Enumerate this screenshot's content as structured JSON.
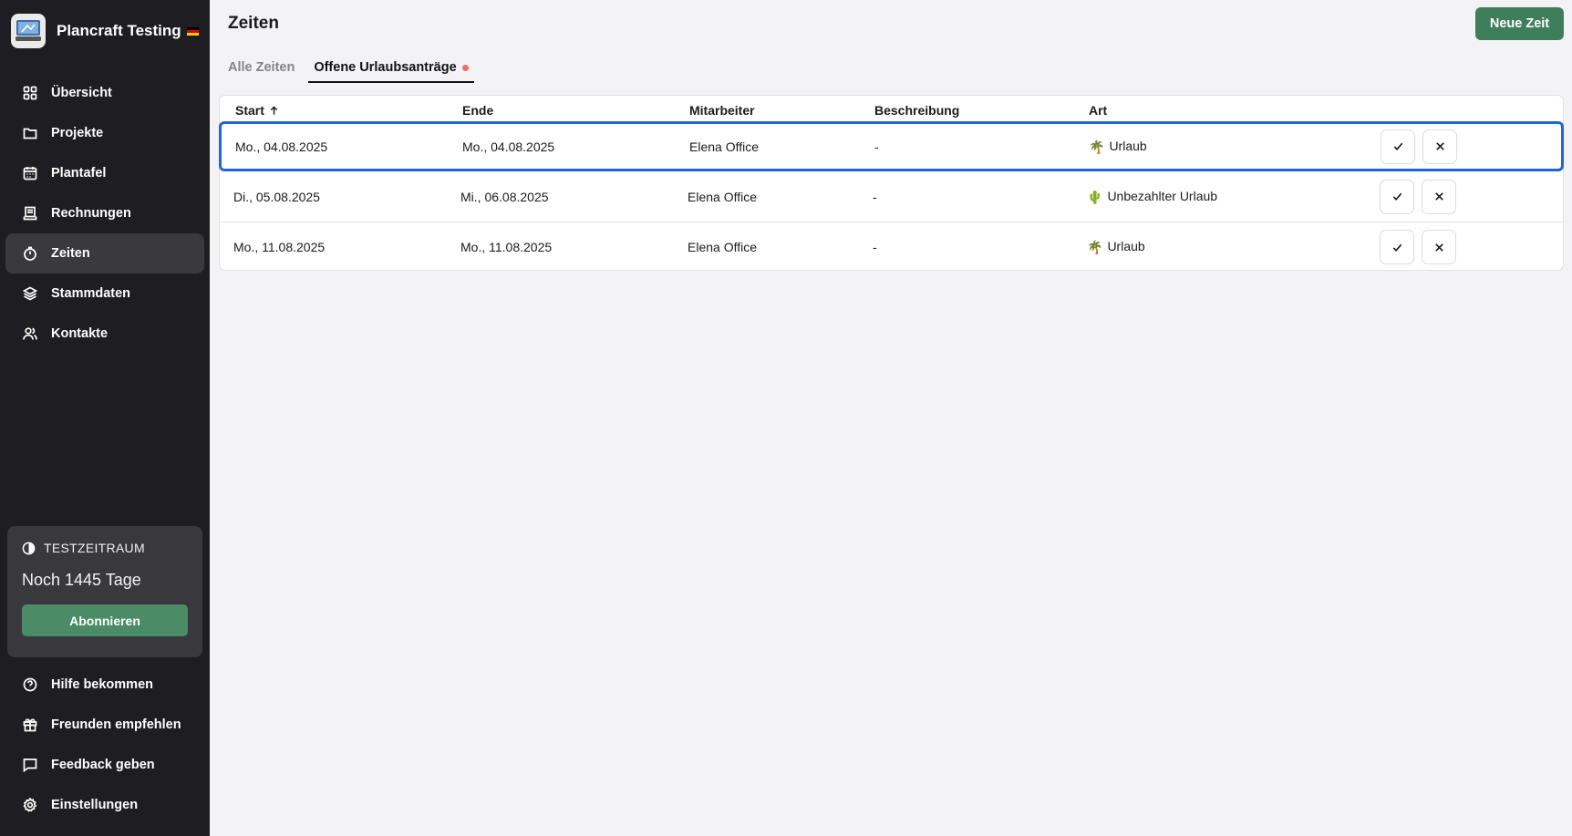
{
  "app": {
    "name": "Plancraft Testing",
    "flag_icon": "german-flag-icon"
  },
  "sidebar": {
    "items": [
      {
        "label": "Übersicht",
        "icon": "grid-icon"
      },
      {
        "label": "Projekte",
        "icon": "folder-icon"
      },
      {
        "label": "Plantafel",
        "icon": "calendar-icon"
      },
      {
        "label": "Rechnungen",
        "icon": "receipt-icon"
      },
      {
        "label": "Zeiten",
        "icon": "timer-icon",
        "active": true
      },
      {
        "label": "Stammdaten",
        "icon": "layers-icon"
      },
      {
        "label": "Kontakte",
        "icon": "users-icon"
      }
    ],
    "trial": {
      "label": "TESTZEITRAUM",
      "days": "Noch 1445 Tage",
      "button": "Abonnieren"
    },
    "bottom_items": [
      {
        "label": "Hilfe bekommen",
        "icon": "help-circle-icon"
      },
      {
        "label": "Freunden empfehlen",
        "icon": "gift-icon"
      },
      {
        "label": "Feedback geben",
        "icon": "message-square-icon"
      },
      {
        "label": "Einstellungen",
        "icon": "gear-icon"
      }
    ]
  },
  "header": {
    "title": "Zeiten",
    "new_button": "Neue Zeit"
  },
  "tabs": [
    {
      "label": "Alle Zeiten",
      "active": false
    },
    {
      "label": "Offene Urlaubsanträge",
      "active": true,
      "badge_color": "#f0706a"
    }
  ],
  "table": {
    "columns": [
      "Start",
      "Ende",
      "Mitarbeiter",
      "Beschreibung",
      "Art"
    ],
    "sort_column": "Start",
    "sort_direction": "ascending",
    "rows": [
      {
        "start": "Mo., 04.08.2025",
        "ende": "Mo., 04.08.2025",
        "mitarbeiter": "Elena Office",
        "beschreibung": "-",
        "art": "Urlaub",
        "art_icon": "🌴",
        "selected": true
      },
      {
        "start": "Di., 05.08.2025",
        "ende": "Mi., 06.08.2025",
        "mitarbeiter": "Elena Office",
        "beschreibung": "-",
        "art": "Unbezahlter Urlaub",
        "art_icon": "🌵",
        "selected": false
      },
      {
        "start": "Mo., 11.08.2025",
        "ende": "Mo., 11.08.2025",
        "mitarbeiter": "Elena Office",
        "beschreibung": "-",
        "art": "Urlaub",
        "art_icon": "🌴",
        "selected": false
      }
    ]
  },
  "colors": {
    "sidebar_bg": "#1e1d21",
    "primary_green": "#3e7e5b",
    "selection_blue": "#1f66d6"
  }
}
